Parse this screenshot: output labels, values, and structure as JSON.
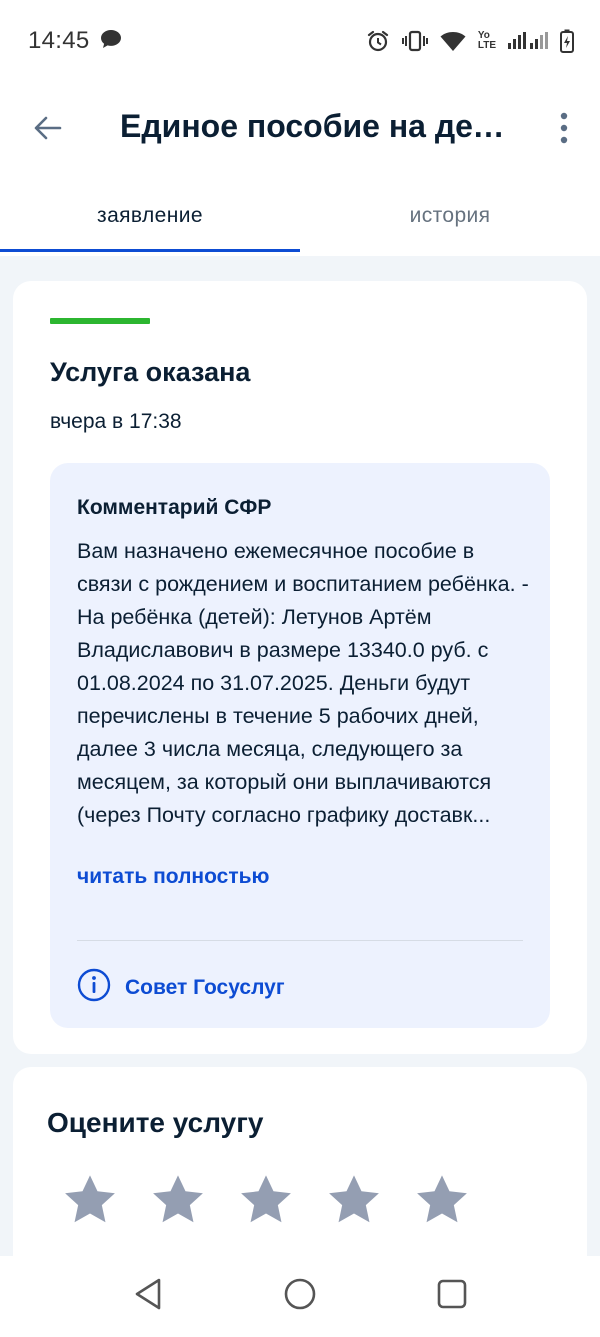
{
  "status_bar": {
    "time": "14:45",
    "lte_label_top": "Yo",
    "lte_label_bottom": "LTE"
  },
  "header": {
    "title": "Единое пособие на детей"
  },
  "tabs": [
    {
      "label": "заявление",
      "active": true
    },
    {
      "label": "история",
      "active": false
    }
  ],
  "status_card": {
    "status": "Услуга оказана",
    "status_color": "#2cb630",
    "date": "вчера в 17:38",
    "comment": {
      "title": "Комментарий СФР",
      "text": "Вам назначено ежемесячное пособие в связи с рождением и воспитанием ребёнка. - На ребёнка (детей): Летунов Артём Владиславович в размере 13340.0 руб. с 01.08.2024 по 31.07.2025. Деньги будут перечислены в течение 5 рабочих дней, далее 3 числа месяца, следующего за месяцем, за который они выплачиваются (через Почту согласно графику доставк...",
      "read_more": "читать полностью",
      "tip_label": "Совет Госуслуг"
    }
  },
  "rating": {
    "title": "Оцените услугу",
    "stars_total": 5,
    "stars_selected": 0,
    "star_color": "#949eb2"
  },
  "colors": {
    "accent": "#0d4cd3",
    "text": "#0b1f33",
    "comment_bg": "#edf2fe"
  },
  "icons": {
    "back": "arrow-left-icon",
    "more": "more-vertical-icon",
    "tip": "info-circle-icon",
    "nav_back": "triangle-back-icon",
    "nav_home": "circle-home-icon",
    "nav_recents": "square-recents-icon"
  }
}
